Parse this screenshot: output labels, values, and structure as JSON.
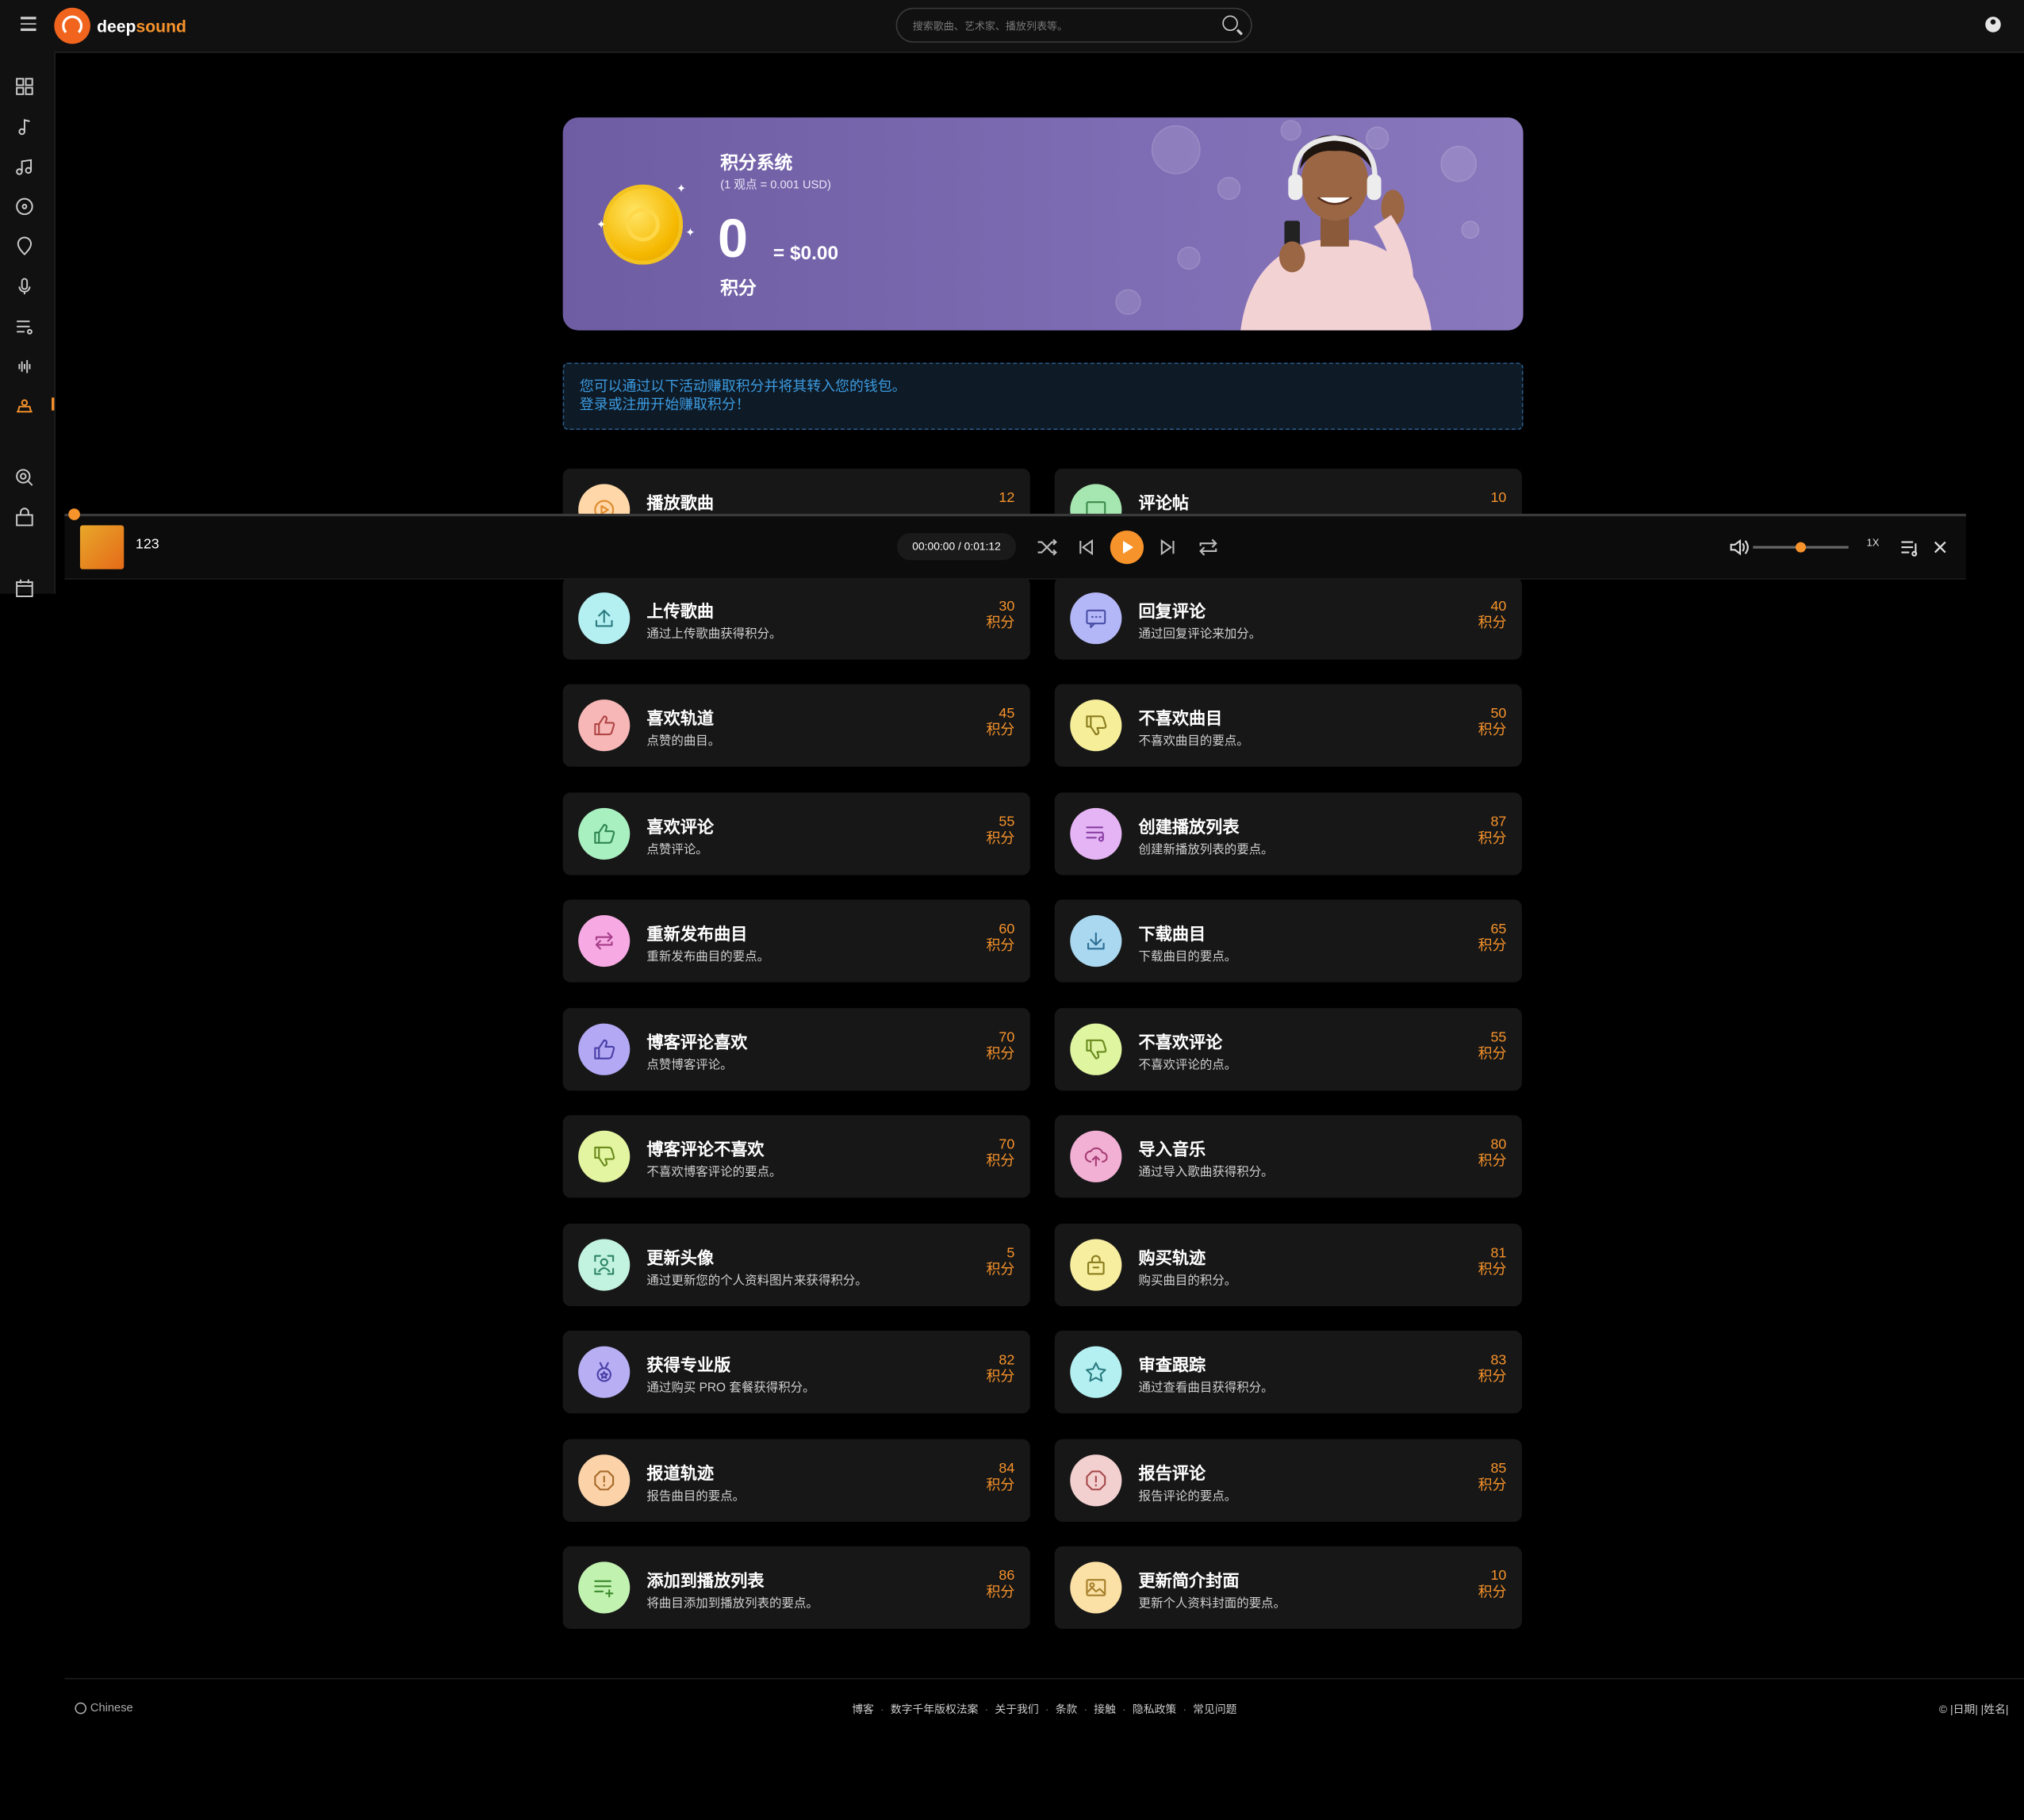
{
  "header": {
    "logo_prefix": "deep",
    "logo_suffix": "sound",
    "search_placeholder": "搜索歌曲、艺术家、播放列表等。"
  },
  "hero": {
    "title": "积分系统",
    "rate": "(1 观点 = 0.001 USD)",
    "points": "0",
    "usd": "= $0.00",
    "unit": "积分"
  },
  "alert": {
    "line1": "您可以通过以下活动赚取积分并将其转入您的钱包。",
    "line2": "登录或注册开始赚取积分！"
  },
  "cards": [
    {
      "title": "播放歌曲",
      "desc": "",
      "points": "12",
      "unit": "",
      "color": "#ffd7a8",
      "stroke": "#e08a2b",
      "icon": "play-circle"
    },
    {
      "title": "评论帖",
      "desc": "",
      "points": "10",
      "unit": "",
      "color": "#a6e6b0",
      "stroke": "#3c8a4a",
      "icon": "comment"
    },
    {
      "title": "上传歌曲",
      "desc": "通过上传歌曲获得积分。",
      "points": "30",
      "unit": "积分",
      "color": "#b4f0f2",
      "stroke": "#2b7b80",
      "icon": "upload"
    },
    {
      "title": "回复评论",
      "desc": "通过回复评论来加分。",
      "points": "40",
      "unit": "积分",
      "color": "#b4b7f7",
      "stroke": "#4a4fa6",
      "icon": "reply"
    },
    {
      "title": "喜欢轨道",
      "desc": "点赞的曲目。",
      "points": "45",
      "unit": "积分",
      "color": "#f8b7b7",
      "stroke": "#b04545",
      "icon": "thumbs-up"
    },
    {
      "title": "不喜欢曲目",
      "desc": "不喜欢曲目的要点。",
      "points": "50",
      "unit": "积分",
      "color": "#f7ee9a",
      "stroke": "#8a7d1e",
      "icon": "thumbs-down"
    },
    {
      "title": "喜欢评论",
      "desc": "点赞评论。",
      "points": "55",
      "unit": "积分",
      "color": "#a9f0c0",
      "stroke": "#2e8550",
      "icon": "thumbs-up"
    },
    {
      "title": "创建播放列表",
      "desc": "创建新播放列表的要点。",
      "points": "87",
      "unit": "积分",
      "color": "#e4b4f4",
      "stroke": "#8a3fa6",
      "icon": "playlist"
    },
    {
      "title": "重新发布曲目",
      "desc": "重新发布曲目的要点。",
      "points": "60",
      "unit": "积分",
      "color": "#f6a9e2",
      "stroke": "#a63d88",
      "icon": "repost"
    },
    {
      "title": "下载曲目",
      "desc": "下载曲目的要点。",
      "points": "65",
      "unit": "积分",
      "color": "#a9d8f0",
      "stroke": "#2e6f94",
      "icon": "download"
    },
    {
      "title": "博客评论喜欢",
      "desc": "点赞博客评论。",
      "points": "70",
      "unit": "积分",
      "color": "#b2a8f4",
      "stroke": "#4a3fa6",
      "icon": "thumbs-up"
    },
    {
      "title": "不喜欢评论",
      "desc": "不喜欢评论的点。",
      "points": "55",
      "unit": "积分",
      "color": "#dff5a0",
      "stroke": "#6a8a1e",
      "icon": "thumbs-down"
    },
    {
      "title": "博客评论不喜欢",
      "desc": "不喜欢博客评论的要点。",
      "points": "70",
      "unit": "积分",
      "color": "#e3f5a0",
      "stroke": "#6a8a1e",
      "icon": "thumbs-down"
    },
    {
      "title": "导入音乐",
      "desc": "通过导入歌曲获得积分。",
      "points": "80",
      "unit": "积分",
      "color": "#f2b0d4",
      "stroke": "#a63d75",
      "icon": "cloud-upload"
    },
    {
      "title": "更新头像",
      "desc": "通过更新您的个人资料图片来获得积分。",
      "points": "5",
      "unit": "积分",
      "color": "#c2f2e0",
      "stroke": "#2e8566",
      "icon": "avatar"
    },
    {
      "title": "购买轨迹",
      "desc": "购买曲目的积分。",
      "points": "81",
      "unit": "积分",
      "color": "#f8eea0",
      "stroke": "#8a7d1e",
      "icon": "bag"
    },
    {
      "title": "获得专业版",
      "desc": "通过购买 PRO 套餐获得积分。",
      "points": "82",
      "unit": "积分",
      "color": "#b7aef4",
      "stroke": "#4a3fa6",
      "icon": "medal"
    },
    {
      "title": "审查跟踪",
      "desc": "通过查看曲目获得积分。",
      "points": "83",
      "unit": "积分",
      "color": "#b4f0f2",
      "stroke": "#2b7b80",
      "icon": "star"
    },
    {
      "title": "报道轨迹",
      "desc": "报告曲目的要点。",
      "points": "84",
      "unit": "积分",
      "color": "#fcd3a8",
      "stroke": "#a66a2b",
      "icon": "report"
    },
    {
      "title": "报告评论",
      "desc": "报告评论的要点。",
      "points": "85",
      "unit": "积分",
      "color": "#f3d0d0",
      "stroke": "#a64a4a",
      "icon": "report"
    },
    {
      "title": "添加到播放列表",
      "desc": "将曲目添加到播放列表的要点。",
      "points": "86",
      "unit": "积分",
      "color": "#c2f2b0",
      "stroke": "#3c8a2e",
      "icon": "playlist-add"
    },
    {
      "title": "更新简介封面",
      "desc": "更新个人资料封面的要点。",
      "points": "10",
      "unit": "积分",
      "color": "#fbe1a6",
      "stroke": "#a6802b",
      "icon": "image"
    }
  ],
  "player": {
    "track": "123",
    "time": "00:00:00 / 0:01:12",
    "speed": "1X",
    "volume_fraction": 0.5
  },
  "footer": {
    "language": "Chinese",
    "links": [
      "博客",
      "数字千年版权法案",
      "关于我们",
      "条款",
      "接触",
      "隐私政策",
      "常见问题"
    ],
    "copyright": "© |日期| |姓名|"
  }
}
